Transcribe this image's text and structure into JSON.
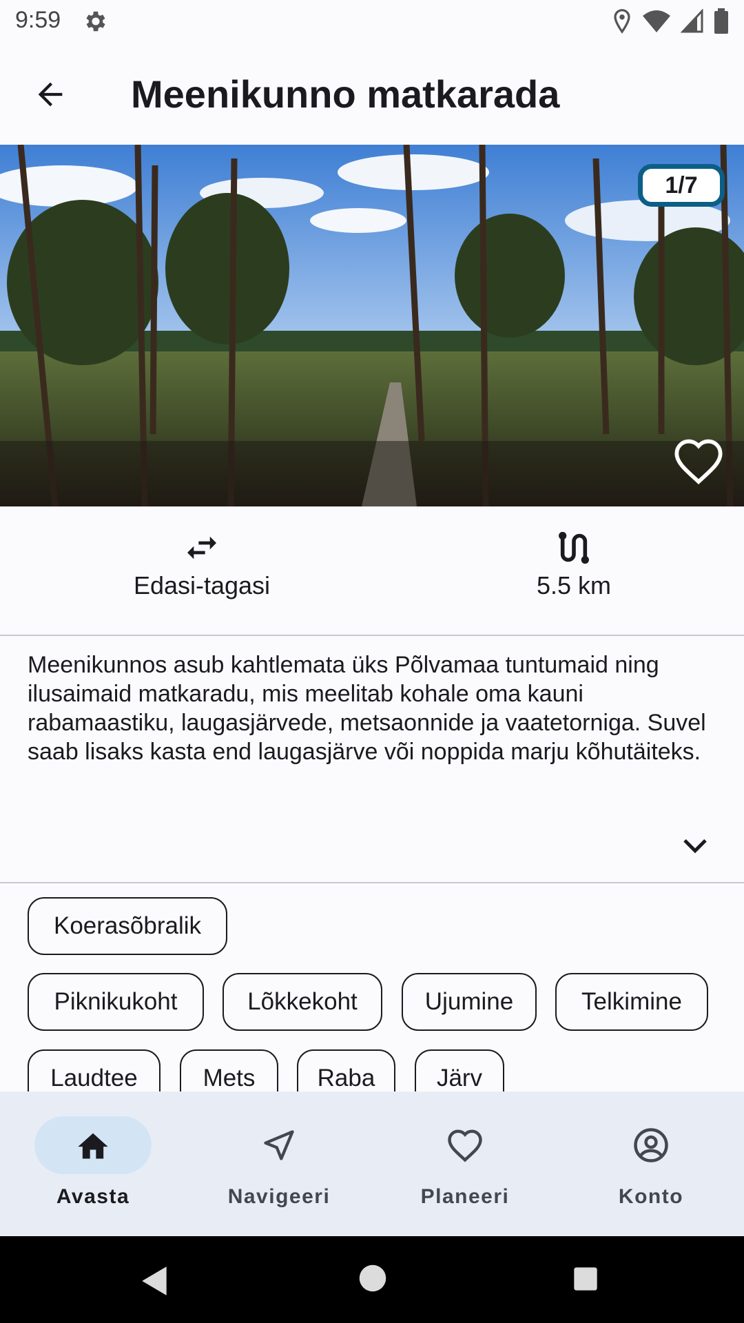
{
  "status_bar": {
    "time": "9:59",
    "icons": [
      "gear-icon",
      "location-icon",
      "wifi-icon",
      "signal-icon",
      "battery-icon"
    ]
  },
  "app_bar": {
    "title": "Meenikunno matkarada",
    "back_icon": "arrow-back-icon"
  },
  "hero": {
    "counter": "1/7",
    "counter_border_color": "#0b5f87",
    "favorite_icon": "heart-outline-icon"
  },
  "stats": {
    "route_type": {
      "icon": "swap-arrows-icon",
      "label": "Edasi-tagasi"
    },
    "distance": {
      "icon": "route-icon",
      "label": "5.5 km"
    }
  },
  "description": {
    "text": "Meenikunnos asub kahtlemata üks Põlvamaa tuntumaid ning ilusaimaid matkaradu, mis meelitab kohale oma kauni rabamaastiku, laugasjärvede, metsaonnide ja vaatetorniga. Suvel saab lisaks kasta end laugasjärve või noppida marju kõhutäiteks.",
    "expand_icon": "chevron-down-icon"
  },
  "tags": {
    "row1": [
      "Koerasõbralik"
    ],
    "row2": [
      "Piknikukoht",
      "Lõkkekoht",
      "Ujumine",
      "Telkimine"
    ],
    "row3": [
      "Laudtee",
      "Mets",
      "Raba",
      "Järv"
    ]
  },
  "bottom_nav": {
    "items": [
      {
        "label": "Avasta",
        "icon": "home-icon",
        "active": true
      },
      {
        "label": "Navigeeri",
        "icon": "navigation-arrow-icon",
        "active": false
      },
      {
        "label": "Planeeri",
        "icon": "heart-outline-icon",
        "active": false
      },
      {
        "label": "Konto",
        "icon": "account-circle-icon",
        "active": false
      }
    ]
  },
  "colors": {
    "background": "#fbfbfe",
    "nav_background": "#e8edf5",
    "active_pill": "#d3e4f5",
    "accent": "#0b5f87"
  }
}
